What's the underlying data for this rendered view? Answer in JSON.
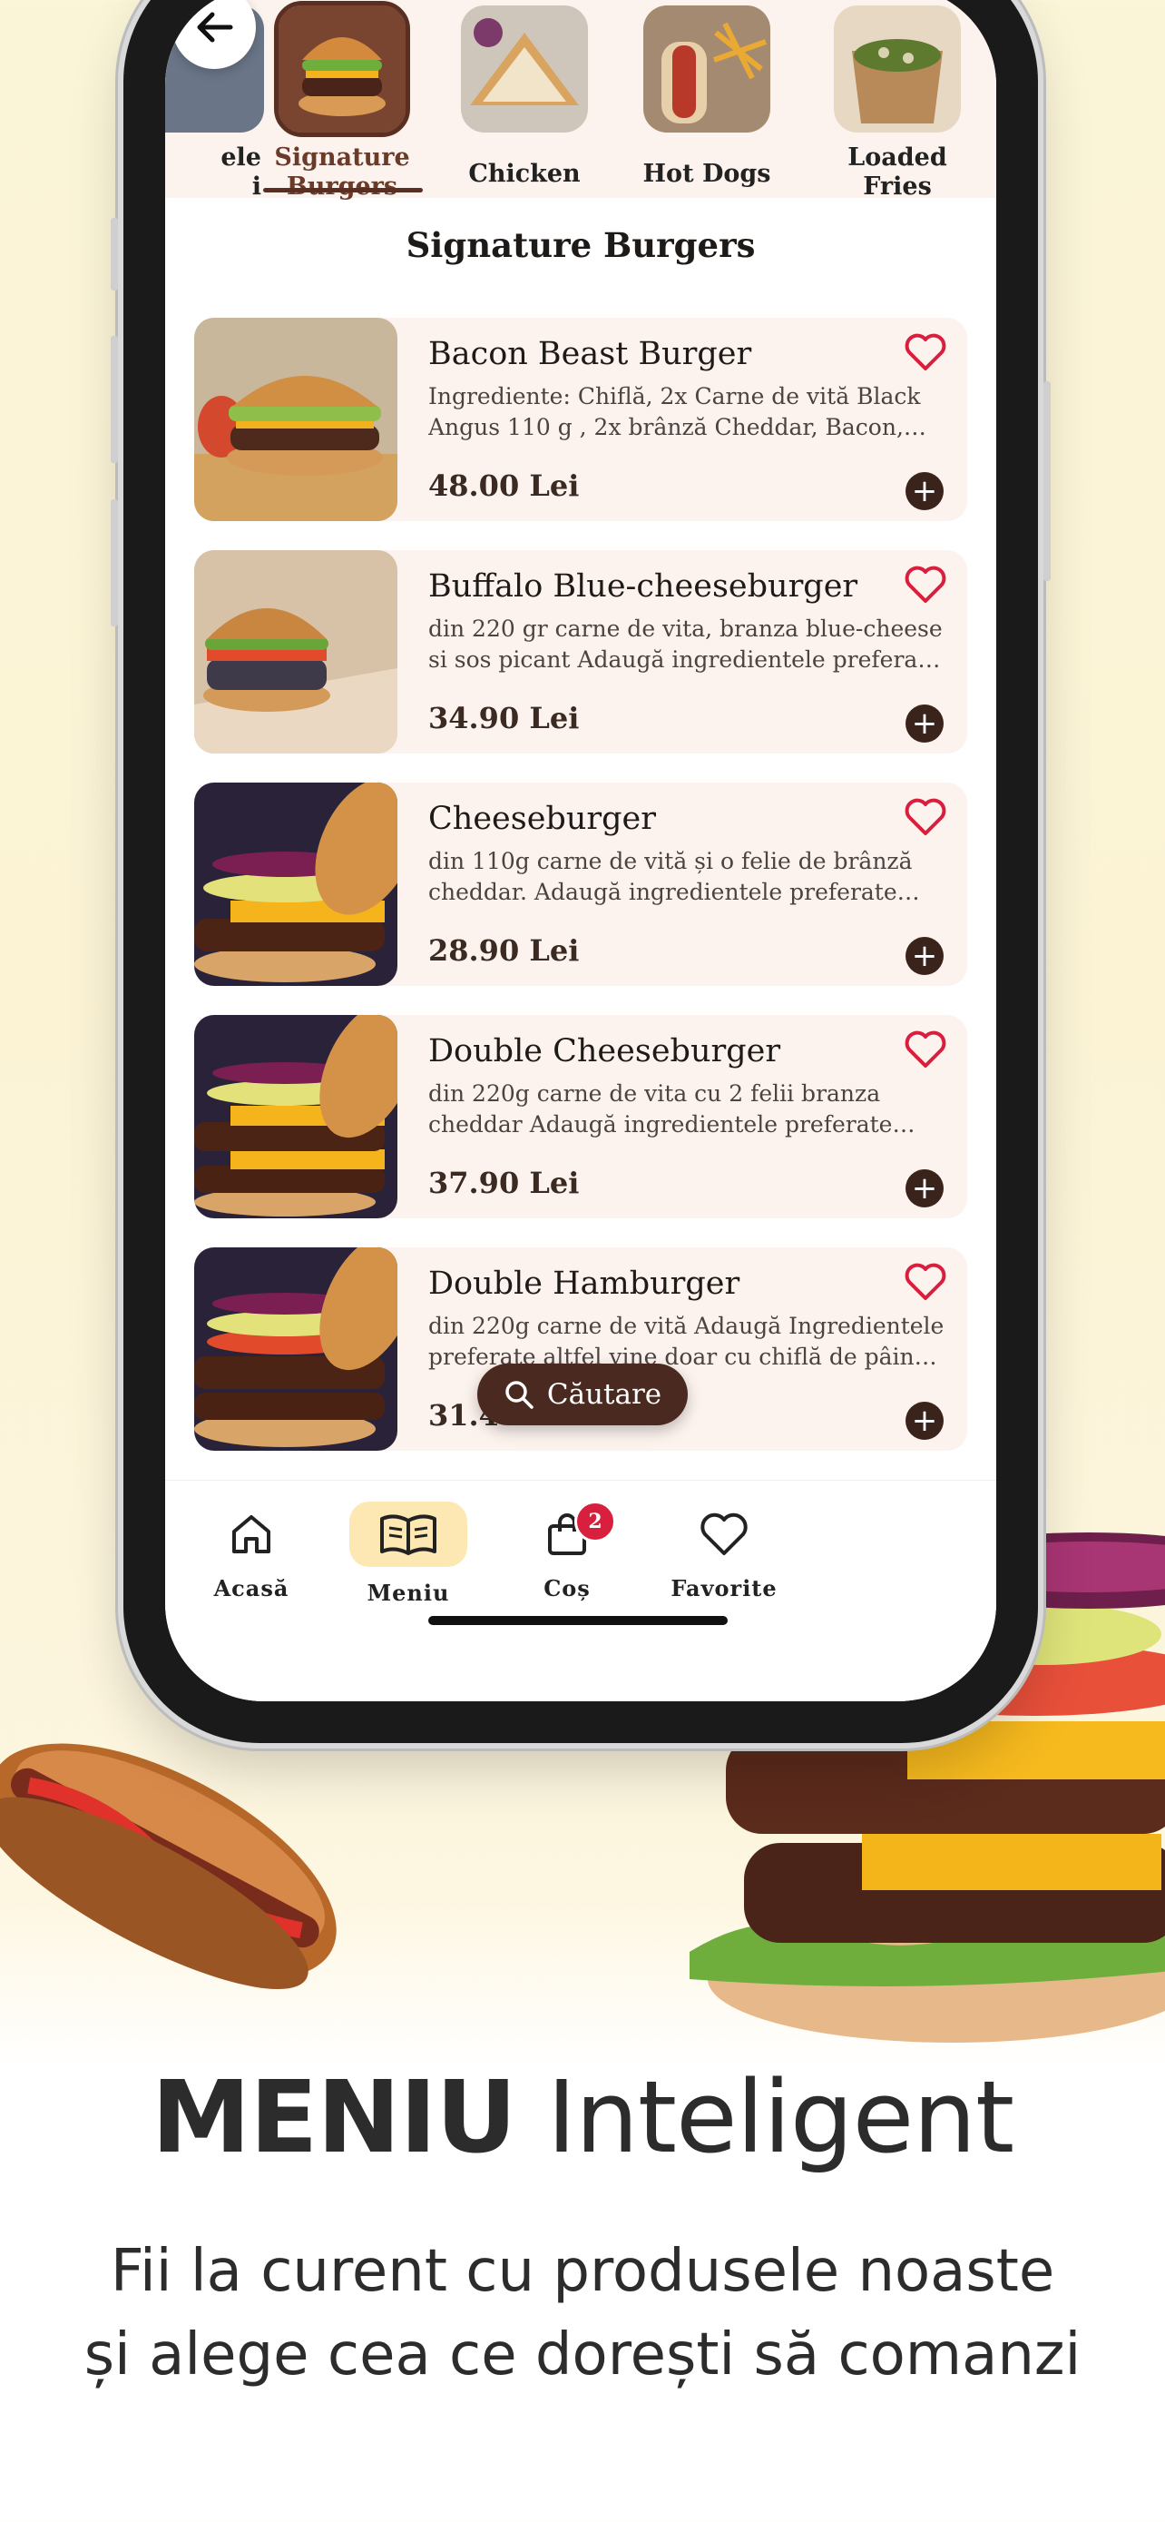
{
  "categories": [
    {
      "label": "ele\ni",
      "active": false,
      "icon": "partial-category-image"
    },
    {
      "label": "Signature\nBurgers",
      "active": true,
      "icon": "burger-image"
    },
    {
      "label": "Chicken",
      "active": false,
      "icon": "chicken-sandwich-image"
    },
    {
      "label": "Hot Dogs",
      "active": false,
      "icon": "hot-dog-image"
    },
    {
      "label": "Loaded\nFries",
      "active": false,
      "icon": "loaded-fries-image"
    }
  ],
  "section_title": "Signature Burgers",
  "products": [
    {
      "name": "Bacon Beast Burger",
      "description": "Ingrediente: Chiflă, 2x Carne de vită Black Angus 110 g , 2x brânză Cheddar, Bacon, salat...",
      "price": "48.00 Lei"
    },
    {
      "name": "Buffalo Blue-cheeseburger",
      "description": "din 220 gr carne de vita, branza blue-cheese si sos picant Adaugă ingredientele preferate altf...",
      "price": "34.90 Lei"
    },
    {
      "name": "Cheeseburger",
      "description": "din 110g carne de vită și o felie de brânză cheddar. Adaugă ingredientele preferate altfe...",
      "price": "28.90 Lei"
    },
    {
      "name": "Double Cheeseburger",
      "description": "din 220g carne de vita cu 2 felii branza cheddar Adaugă ingredientele preferate altfel vine doa...",
      "price": "37.90 Lei"
    },
    {
      "name": "Double Hamburger",
      "description": "din 220g carne de vită Adaugă Ingredientele preferate altfel vine doar cu chiflă de pâine și ...",
      "price": "31.4"
    }
  ],
  "search": {
    "label": "Căutare",
    "icon": "search-icon"
  },
  "nav": [
    {
      "label": "Acasă",
      "icon": "home-icon",
      "active": false
    },
    {
      "label": "Meniu",
      "icon": "menu-book-icon",
      "active": true
    },
    {
      "label": "Coș",
      "icon": "bag-icon",
      "active": false,
      "badge": "2"
    },
    {
      "label": "Favorite",
      "icon": "heart-icon",
      "active": false
    }
  ],
  "headline": {
    "bold": "MENIU",
    "regular": "Inteligent"
  },
  "subline": {
    "line1": "Fii la curent cu produsele noaste",
    "line2": "și alege cea ce dorești să comanzi"
  },
  "colors": {
    "accent_brown": "#5a2f22",
    "heart_red": "#d81f3d",
    "card_bg": "#fdf3ee",
    "active_tab_bg": "#fde7b3"
  }
}
